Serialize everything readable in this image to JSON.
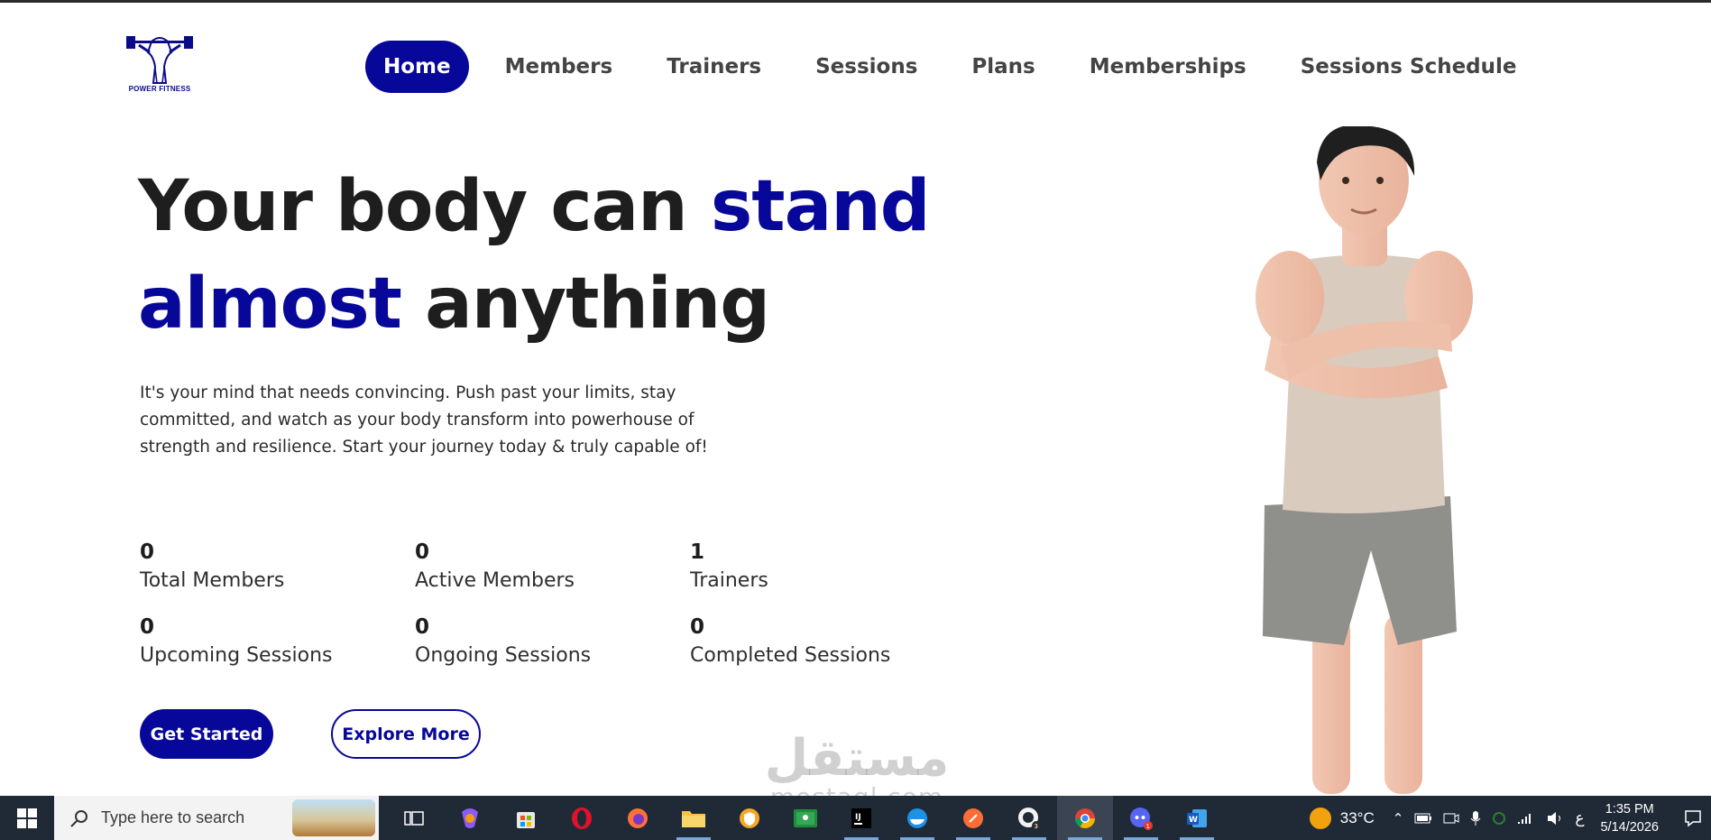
{
  "brand": {
    "logo_text": "POWER FITNESS",
    "accent_color": "#07079a"
  },
  "nav": {
    "items": [
      {
        "label": "Home",
        "active": true
      },
      {
        "label": "Members"
      },
      {
        "label": "Trainers"
      },
      {
        "label": "Sessions"
      },
      {
        "label": "Plans"
      },
      {
        "label": "Memberships"
      },
      {
        "label": "Sessions Schedule"
      }
    ]
  },
  "hero": {
    "title_part1": "Your body can ",
    "title_accent1": "stand almost",
    "title_part2": " anything",
    "description": "It's your mind that needs convincing. Push past your limits, stay committed, and watch as your body transform into powerhouse of strength and resilience. Start your journey today & truly capable of!"
  },
  "stats": [
    {
      "value": "0",
      "label": "Total Members"
    },
    {
      "value": "0",
      "label": "Active Members"
    },
    {
      "value": "1",
      "label": "Trainers"
    },
    {
      "value": "0",
      "label": "Upcoming Sessions"
    },
    {
      "value": "0",
      "label": "Ongoing Sessions"
    },
    {
      "value": "0",
      "label": "Completed Sessions"
    }
  ],
  "buttons": {
    "primary": "Get Started",
    "secondary": "Explore More"
  },
  "watermark": {
    "arabic": "مستقل",
    "latin": "mostaql.com"
  },
  "taskbar": {
    "search_placeholder": "Type here to search",
    "apps": [
      "task-view",
      "copilot",
      "microsoft-store",
      "opera",
      "firefox",
      "file-explorer",
      "vpn",
      "google-classroom",
      "intellij",
      "docker",
      "postman",
      "github-desktop",
      "chrome",
      "discord",
      "word"
    ],
    "weather": "33°C",
    "input_language": "ع",
    "time": "1:35 PM",
    "date": "5/14/2026"
  }
}
